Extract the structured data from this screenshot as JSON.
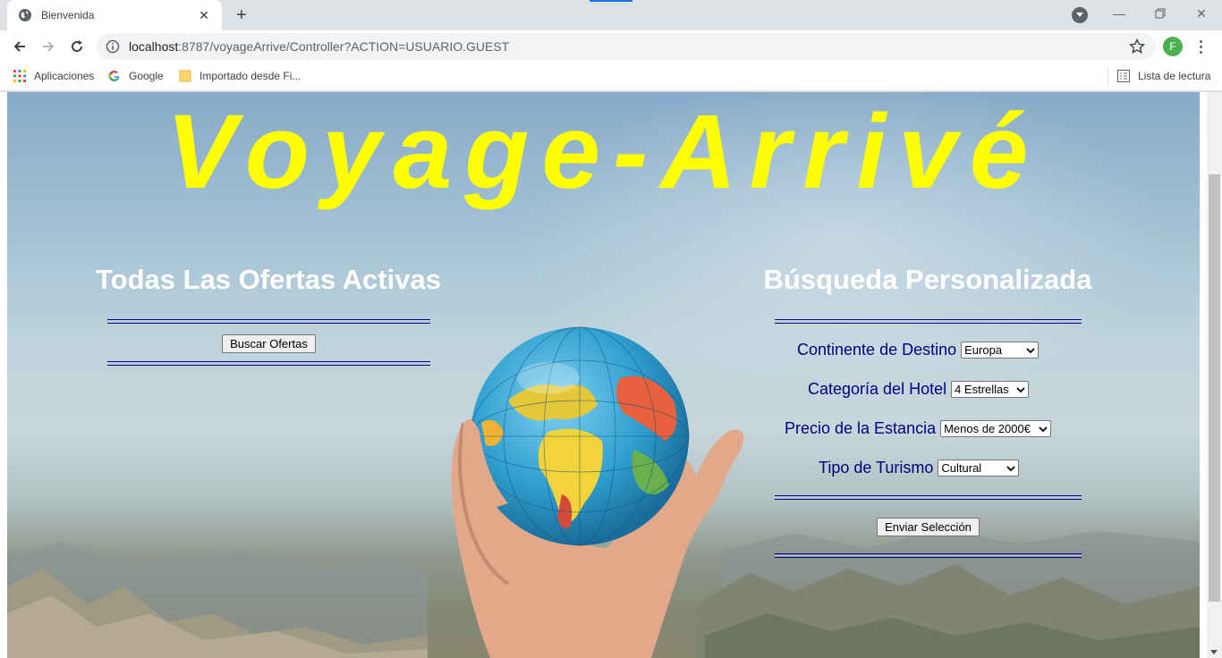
{
  "browser": {
    "tab_title": "Bienvenida",
    "url_host": "localhost",
    "url_rest": ":8787/voyageArrive/Controller?ACTION=USUARIO.GUEST",
    "profile_initial": "F",
    "bookmarks": [
      "Aplicaciones",
      "Google",
      "Importado desde Fi..."
    ],
    "reading_list": "Lista de lectura"
  },
  "page": {
    "site_title": "Voyage-Arrivé",
    "left": {
      "heading": "Todas Las Ofertas Activas",
      "button": "Buscar Ofertas"
    },
    "right": {
      "heading": "Búsqueda Personalizada",
      "fields": [
        {
          "label": "Continente de Destino",
          "value": "Europa"
        },
        {
          "label": "Categoría del Hotel",
          "value": "4 Estrellas"
        },
        {
          "label": "Precio de la Estancia",
          "value": "Menos de 2000€"
        },
        {
          "label": "Tipo de Turismo",
          "value": "Cultural"
        }
      ],
      "submit": "Enviar Selección"
    }
  },
  "colors": {
    "title": "#ffff00",
    "heading": "#ffffff",
    "label": "#000080"
  }
}
